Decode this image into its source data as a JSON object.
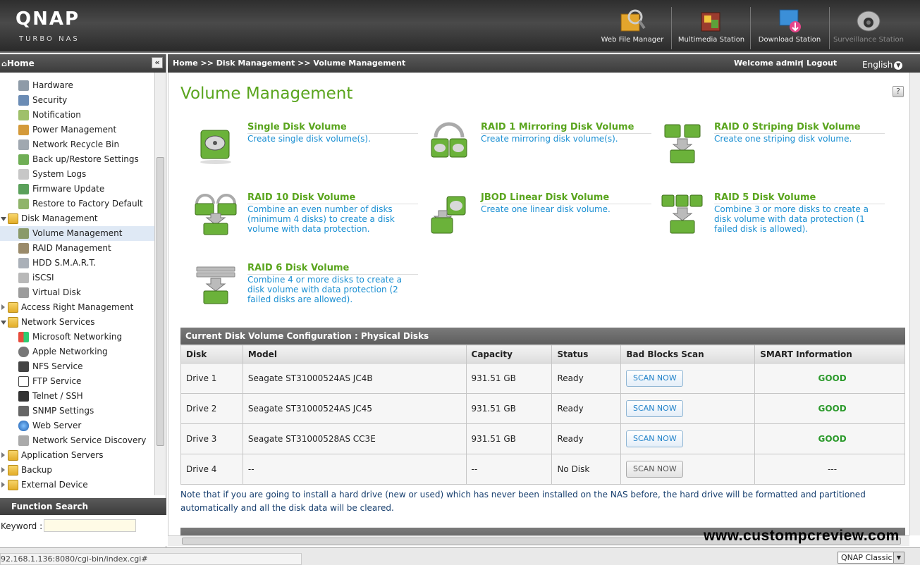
{
  "brand": {
    "name": "QNAP",
    "subtitle": "TURBO NAS"
  },
  "toolbar": [
    {
      "label": "Web File Manager",
      "icon": "web-file-manager-icon"
    },
    {
      "label": "Multimedia Station",
      "icon": "multimedia-station-icon"
    },
    {
      "label": "Download Station",
      "icon": "download-station-icon"
    },
    {
      "label": "Surveillance Station",
      "icon": "surveillance-station-icon"
    }
  ],
  "sidebar": {
    "title": "Home",
    "collapse": "«",
    "items": [
      {
        "label": "Hardware",
        "icon": "hardware-icon"
      },
      {
        "label": "Security",
        "icon": "security-icon"
      },
      {
        "label": "Notification",
        "icon": "notification-icon"
      },
      {
        "label": "Power Management",
        "icon": "power-icon"
      },
      {
        "label": "Network Recycle Bin",
        "icon": "recycle-bin-icon"
      },
      {
        "label": "Back up/Restore Settings",
        "icon": "backup-icon"
      },
      {
        "label": "System Logs",
        "icon": "logs-icon"
      },
      {
        "label": "Firmware Update",
        "icon": "firmware-icon"
      },
      {
        "label": "Restore to Factory Default",
        "icon": "restore-icon"
      },
      {
        "label": "Disk Management",
        "icon": "folder-icon"
      },
      {
        "label": "Volume Management",
        "icon": "volume-icon"
      },
      {
        "label": "RAID Management",
        "icon": "raid-icon"
      },
      {
        "label": "HDD S.M.A.R.T.",
        "icon": "hdd-icon"
      },
      {
        "label": "iSCSI",
        "icon": "iscsi-icon"
      },
      {
        "label": "Virtual Disk",
        "icon": "virtual-disk-icon"
      },
      {
        "label": "Access Right Management",
        "icon": "folder-icon"
      },
      {
        "label": "Network Services",
        "icon": "folder-icon"
      },
      {
        "label": "Microsoft Networking",
        "icon": "windows-icon"
      },
      {
        "label": "Apple Networking",
        "icon": "apple-icon"
      },
      {
        "label": "NFS Service",
        "icon": "nfs-icon"
      },
      {
        "label": "FTP Service",
        "icon": "ftp-icon"
      },
      {
        "label": "Telnet / SSH",
        "icon": "telnet-icon"
      },
      {
        "label": "SNMP Settings",
        "icon": "snmp-icon"
      },
      {
        "label": "Web Server",
        "icon": "web-server-icon"
      },
      {
        "label": "Network Service Discovery",
        "icon": "discovery-icon"
      },
      {
        "label": "Application Servers",
        "icon": "folder-icon"
      },
      {
        "label": "Backup",
        "icon": "folder-icon"
      },
      {
        "label": "External Device",
        "icon": "folder-icon"
      }
    ],
    "function_search": {
      "title": "Function Search",
      "keyword_label": "Keyword :",
      "keyword_value": ""
    }
  },
  "header": {
    "breadcrumb": "Home >> Disk Management >> Volume Management",
    "welcome": "Welcome admin",
    "separator": "|",
    "logout": "Logout",
    "language": "English"
  },
  "main": {
    "title": "Volume Management",
    "help": "?",
    "options": [
      {
        "title": "Single Disk Volume",
        "desc": "Create single disk volume(s)."
      },
      {
        "title": "RAID 1 Mirroring Disk Volume",
        "desc": "Create mirroring disk volume(s)."
      },
      {
        "title": "RAID 0 Striping Disk Volume",
        "desc": "Create one striping disk volume."
      },
      {
        "title": "RAID 10 Disk Volume",
        "desc": "Combine an even number of disks (minimum 4 disks) to create a disk volume with data protection."
      },
      {
        "title": "JBOD Linear Disk Volume",
        "desc": "Create one linear disk volume."
      },
      {
        "title": "RAID 5 Disk Volume",
        "desc": "Combine 3 or more disks to create a disk volume with data protection (1 failed disk is allowed)."
      },
      {
        "title": "RAID 6 Disk Volume",
        "desc": "Combine 4 or more disks to create a disk volume with data protection (2 failed disks are allowed)."
      }
    ],
    "physical_table": {
      "caption": "Current Disk Volume Configuration : Physical Disks",
      "columns": [
        "Disk",
        "Model",
        "Capacity",
        "Status",
        "Bad Blocks Scan",
        "SMART Information"
      ],
      "rows": [
        {
          "disk": "Drive 1",
          "model": "Seagate ST31000524AS JC4B",
          "capacity": "931.51 GB",
          "status": "Ready",
          "scan": "SCAN NOW",
          "smart": "GOOD"
        },
        {
          "disk": "Drive 2",
          "model": "Seagate ST31000524AS JC45",
          "capacity": "931.51 GB",
          "status": "Ready",
          "scan": "SCAN NOW",
          "smart": "GOOD"
        },
        {
          "disk": "Drive 3",
          "model": "Seagate ST31000528AS CC3E",
          "capacity": "931.51 GB",
          "status": "Ready",
          "scan": "SCAN NOW",
          "smart": "GOOD"
        },
        {
          "disk": "Drive 4",
          "model": "--",
          "capacity": "--",
          "status": "No Disk",
          "scan": "SCAN NOW",
          "smart": "---"
        }
      ]
    },
    "note": "Note that if you are going to install a hard drive (new or used) which has never been installed on the NAS before, the hard drive will be formatted and partitioned automatically and all the disk data will be cleared.",
    "colors": {
      "accent_green": "#5aa51e",
      "link_blue": "#1a8fd2",
      "good_green": "#2c9a2c"
    }
  },
  "statusbar": {
    "url": "92.168.1.136:8080/cgi-bin/index.cgi#",
    "theme": "QNAP Classic"
  },
  "watermark": "www.custompcreview.com"
}
